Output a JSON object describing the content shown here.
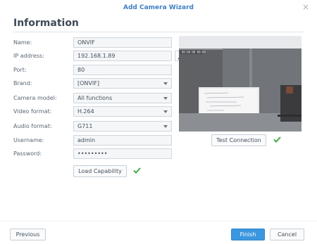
{
  "window": {
    "title": "Add Camera Wizard",
    "close_glyph": "×",
    "close_icon": "close-icon"
  },
  "heading": "Information",
  "form": {
    "fields": [
      {
        "label": "Name:",
        "value": "ONVIF",
        "type": "text"
      },
      {
        "label": "IP address:",
        "value": "192.168.1.89",
        "type": "text-search"
      },
      {
        "label": "Port:",
        "value": "80",
        "type": "text"
      },
      {
        "label": "Brand:",
        "value": "[ONVIF]",
        "type": "select"
      },
      {
        "label": "Camera model:",
        "value": "All functions",
        "type": "select"
      },
      {
        "label": "Video format:",
        "value": "H.264",
        "type": "select"
      },
      {
        "label": "Audio format:",
        "value": "G711",
        "type": "select"
      },
      {
        "label": "Username:",
        "value": "admin",
        "type": "text"
      },
      {
        "label": "Password:",
        "value": "•••••••••",
        "type": "password"
      }
    ],
    "search_icon": "search-icon"
  },
  "buttons": {
    "load_capability": "Load Capability",
    "test_connection": "Test Connection",
    "previous": "Previous",
    "finish": "Finish",
    "cancel": "Cancel"
  },
  "preview": {
    "icon": "camera-preview-image",
    "overlay_text": "00:00:00 00:00"
  },
  "colors": {
    "accent": "#3d7fc5",
    "primary_button": "#3b97df",
    "success_check": "#49a84a"
  }
}
